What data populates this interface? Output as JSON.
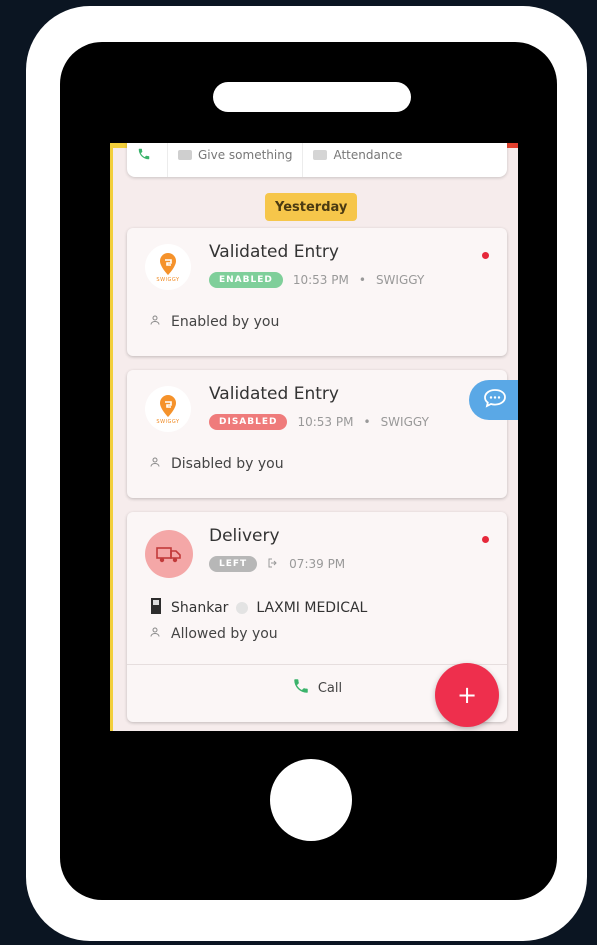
{
  "quick_actions": [
    {
      "label": ""
    },
    {
      "label": "Give something"
    },
    {
      "label": "Attendance"
    }
  ],
  "day_header": "Yesterday",
  "entries": [
    {
      "title": "Validated Entry",
      "status": "ENABLED",
      "time": "10:53 PM",
      "source": "SWIGGY",
      "logo_text": "SWIGGY",
      "note": "Enabled by you",
      "unread": true
    },
    {
      "title": "Validated Entry",
      "status": "DISABLED",
      "time": "10:53 PM",
      "source": "SWIGGY",
      "logo_text": "SWIGGY",
      "note": "Disabled by you",
      "unread": false
    },
    {
      "title": "Delivery",
      "status": "LEFT",
      "time": "07:39 PM",
      "visitor_name": "Shankar",
      "company": "LAXMI MEDICAL",
      "note": "Allowed by you",
      "call_label": "Call",
      "unread": true
    }
  ],
  "separator": "•",
  "fab_symbol": "+",
  "colors": {
    "accent_yellow": "#f6c64a",
    "enabled_green": "#7fcf9a",
    "disabled_red": "#ef7b7b",
    "fab_red": "#ee2f4d",
    "chat_blue": "#5aa8e6"
  }
}
